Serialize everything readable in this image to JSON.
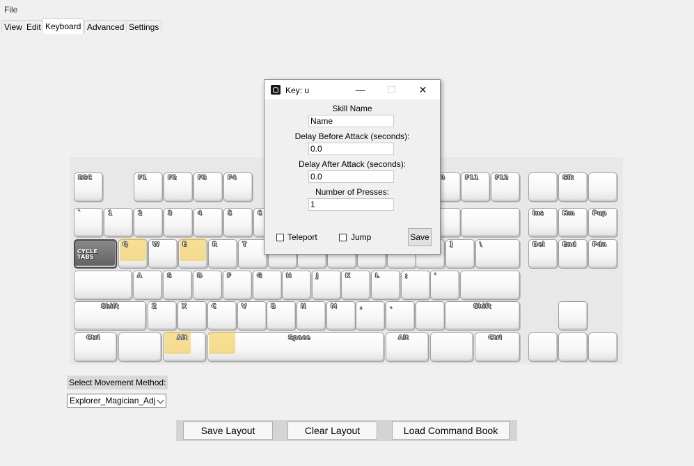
{
  "menubar": {
    "file": "File"
  },
  "tabs": [
    {
      "label": "View"
    },
    {
      "label": "Edit"
    },
    {
      "label": "Keyboard"
    },
    {
      "label": "Advanced"
    },
    {
      "label": "Settings"
    }
  ],
  "keyboard": {
    "keys": [
      {
        "name": "esc",
        "label": "ESC"
      },
      {
        "name": "f1",
        "label": "F1"
      },
      {
        "name": "f2",
        "label": "F2"
      },
      {
        "name": "f3",
        "label": "F3"
      },
      {
        "name": "f4",
        "label": "F4"
      },
      {
        "name": "f10",
        "label": "10"
      },
      {
        "name": "f11",
        "label": "F11"
      },
      {
        "name": "f12",
        "label": "F12"
      },
      {
        "name": "prtsc",
        "label": ""
      },
      {
        "name": "slk",
        "label": "Slk"
      },
      {
        "name": "pause",
        "label": ""
      },
      {
        "name": "backtick",
        "label": "`"
      },
      {
        "name": "1",
        "label": "1"
      },
      {
        "name": "2",
        "label": "2"
      },
      {
        "name": "3",
        "label": "3"
      },
      {
        "name": "4",
        "label": "4"
      },
      {
        "name": "5",
        "label": "5"
      },
      {
        "name": "6",
        "label": "6"
      },
      {
        "name": "minus",
        "label": ""
      },
      {
        "name": "backspace",
        "label": ""
      },
      {
        "name": "ins",
        "label": "Ins"
      },
      {
        "name": "hm",
        "label": "Hm"
      },
      {
        "name": "pup",
        "label": "Pup"
      },
      {
        "name": "cycle-tabs",
        "label": "CYCLE TABS"
      },
      {
        "name": "q",
        "label": "Q"
      },
      {
        "name": "w",
        "label": "W"
      },
      {
        "name": "e",
        "label": "E"
      },
      {
        "name": "r",
        "label": "R"
      },
      {
        "name": "t",
        "label": "T"
      },
      {
        "name": "y",
        "label": ""
      },
      {
        "name": "u",
        "label": ""
      },
      {
        "name": "i",
        "label": ""
      },
      {
        "name": "o",
        "label": ""
      },
      {
        "name": "p",
        "label": ""
      },
      {
        "name": "lbracket",
        "label": ""
      },
      {
        "name": "rbracket",
        "label": "]"
      },
      {
        "name": "backslash",
        "label": "\\"
      },
      {
        "name": "del",
        "label": "Del"
      },
      {
        "name": "end",
        "label": "End"
      },
      {
        "name": "pdn",
        "label": "Pdn"
      },
      {
        "name": "caps",
        "label": ""
      },
      {
        "name": "a",
        "label": "A"
      },
      {
        "name": "s",
        "label": "S"
      },
      {
        "name": "d",
        "label": "D"
      },
      {
        "name": "f",
        "label": "F"
      },
      {
        "name": "g",
        "label": "G"
      },
      {
        "name": "h",
        "label": "H"
      },
      {
        "name": "j",
        "label": "J"
      },
      {
        "name": "k",
        "label": "K"
      },
      {
        "name": "l",
        "label": "L"
      },
      {
        "name": "semicolon",
        "label": ";"
      },
      {
        "name": "quote",
        "label": "'"
      },
      {
        "name": "enter",
        "label": ""
      },
      {
        "name": "lshift",
        "label": "Shift"
      },
      {
        "name": "z",
        "label": "Z"
      },
      {
        "name": "x",
        "label": "X"
      },
      {
        "name": "c",
        "label": "C"
      },
      {
        "name": "v",
        "label": "V"
      },
      {
        "name": "b",
        "label": "B"
      },
      {
        "name": "n",
        "label": "N"
      },
      {
        "name": "m",
        "label": "M"
      },
      {
        "name": "comma",
        "label": ","
      },
      {
        "name": "period",
        "label": "."
      },
      {
        "name": "slash",
        "label": ""
      },
      {
        "name": "rshift",
        "label": "Shift"
      },
      {
        "name": "up",
        "label": ""
      },
      {
        "name": "lctrl",
        "label": "Ctrl"
      },
      {
        "name": "lwin",
        "label": ""
      },
      {
        "name": "lalt",
        "label": "Alt"
      },
      {
        "name": "space",
        "label": "Space"
      },
      {
        "name": "ralt",
        "label": "Alt"
      },
      {
        "name": "rwin",
        "label": ""
      },
      {
        "name": "rctrl",
        "label": "Ctrl"
      },
      {
        "name": "left",
        "label": ""
      },
      {
        "name": "down",
        "label": ""
      },
      {
        "name": "right",
        "label": ""
      }
    ],
    "highlighted": [
      "q",
      "e",
      "lalt",
      "space"
    ],
    "highlight_color": "#f0c43c"
  },
  "dialog": {
    "title": "Key: u",
    "minimize": "—",
    "maximize": "☐",
    "close": "✕",
    "skill_name_label": "Skill Name",
    "skill_name_value": "Name",
    "delay_before_label": "Delay Before Attack (seconds):",
    "delay_before_value": "0.0",
    "delay_after_label": "Delay After Attack (seconds):",
    "delay_after_value": "0.0",
    "presses_label": "Number of Presses:",
    "presses_value": "1",
    "teleport_label": "Teleport",
    "jump_label": "Jump",
    "save_label": "Save"
  },
  "movement": {
    "label": "Select Movement Method:",
    "selected": "Explorer_Magician_Adj"
  },
  "buttons": {
    "save_layout": "Save Layout",
    "clear_layout": "Clear Layout",
    "load_command_book": "Load Command Book"
  }
}
